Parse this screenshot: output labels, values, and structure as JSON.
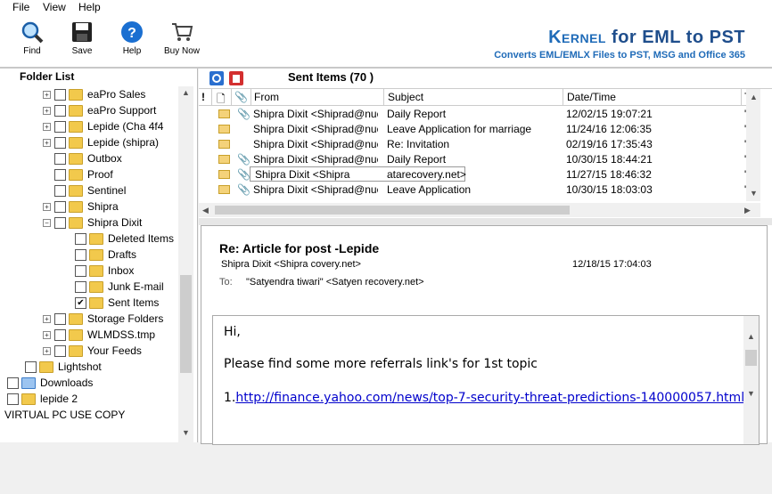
{
  "menu": [
    "File",
    "View",
    "Help"
  ],
  "toolbar": {
    "find": "Find",
    "save": "Save",
    "help": "Help",
    "buy_now": "Buy Now"
  },
  "brand": {
    "kernel": "Kernel",
    "title_rest": " for EML to PST",
    "subtitle": "Converts EML/EMLX Files to PST, MSG and Office 365"
  },
  "folder_list": {
    "title": "Folder List",
    "items": [
      {
        "label": "eaPro Sales",
        "checked": false
      },
      {
        "label": "eaPro Support",
        "checked": false
      },
      {
        "label": "Lepide (Cha 4f4",
        "checked": false
      },
      {
        "label": "Lepide (shipra)",
        "checked": false
      },
      {
        "label": "Outbox",
        "checked": false
      },
      {
        "label": "Proof",
        "checked": false
      },
      {
        "label": "Sentinel",
        "checked": false
      },
      {
        "label": "Shipra",
        "checked": false
      },
      {
        "label": "Shipra Dixit",
        "checked": false
      },
      {
        "label": "Deleted Items",
        "checked": false
      },
      {
        "label": "Drafts",
        "checked": false
      },
      {
        "label": "Inbox",
        "checked": false
      },
      {
        "label": "Junk E-mail",
        "checked": false
      },
      {
        "label": "Sent Items",
        "checked": true
      },
      {
        "label": "Storage Folders",
        "checked": false
      },
      {
        "label": "WLMDSS.tmp",
        "checked": false
      },
      {
        "label": "Your Feeds",
        "checked": false
      },
      {
        "label": "Lightshot",
        "checked": false
      },
      {
        "label": "Downloads",
        "checked": false
      },
      {
        "label": "lepide 2",
        "checked": false
      },
      {
        "label": "VIRTUAL PC USE COPY",
        "checked": false
      }
    ]
  },
  "sent_items": {
    "title": "Sent Items (70 )",
    "columns": [
      "!",
      "",
      "",
      "From",
      "Subject",
      "Date/Time",
      "To"
    ],
    "rows": [
      {
        "from": "Shipra Dixit <Shiprad@nucl...",
        "subject": "Daily Report",
        "date": "12/02/15 19:07:21",
        "to": "\"A",
        "attach": true
      },
      {
        "from": "Shipra Dixit <Shiprad@nucl...",
        "subject": "Leave Application for marriage",
        "date": "11/24/16 12:06:35",
        "to": "\"H",
        "attach": false
      },
      {
        "from": "Shipra Dixit <Shiprad@nucl...",
        "subject": "Re: Invitation",
        "date": "02/19/16 17:35:43",
        "to": "\"V",
        "attach": false
      },
      {
        "from": "Shipra Dixit <Shiprad@nucl...",
        "subject": "Daily Report",
        "date": "10/30/15 18:44:21",
        "to": "\"A",
        "attach": true
      },
      {
        "from": "Shipra Dixit <Shipra",
        "subject": "atarecovery.net>",
        "date": "11/27/15 18:46:32",
        "to": "\"A",
        "attach": true
      },
      {
        "from": "Shipra Dixit <Shiprad@nucl...",
        "subject": "Leave Application",
        "date": "10/30/15 18:03:03",
        "to": "\"H",
        "attach": true
      }
    ]
  },
  "message": {
    "subject": "Re: Article for post -Lepide",
    "from": "Shipra Dixit <Shipra                              covery.net>",
    "date": "12/18/15 17:04:03",
    "to_label": "To:",
    "to": "\"Satyendra tiwari\" <Satyen                              recovery.net>",
    "body_greeting": "Hi,",
    "body_line": "Please find some more referrals link's for 1st topic",
    "body_link_prefix": "1.",
    "body_link": "http://finance.yahoo.com/news/top-7-security-threat-predictions-140000057.html"
  }
}
